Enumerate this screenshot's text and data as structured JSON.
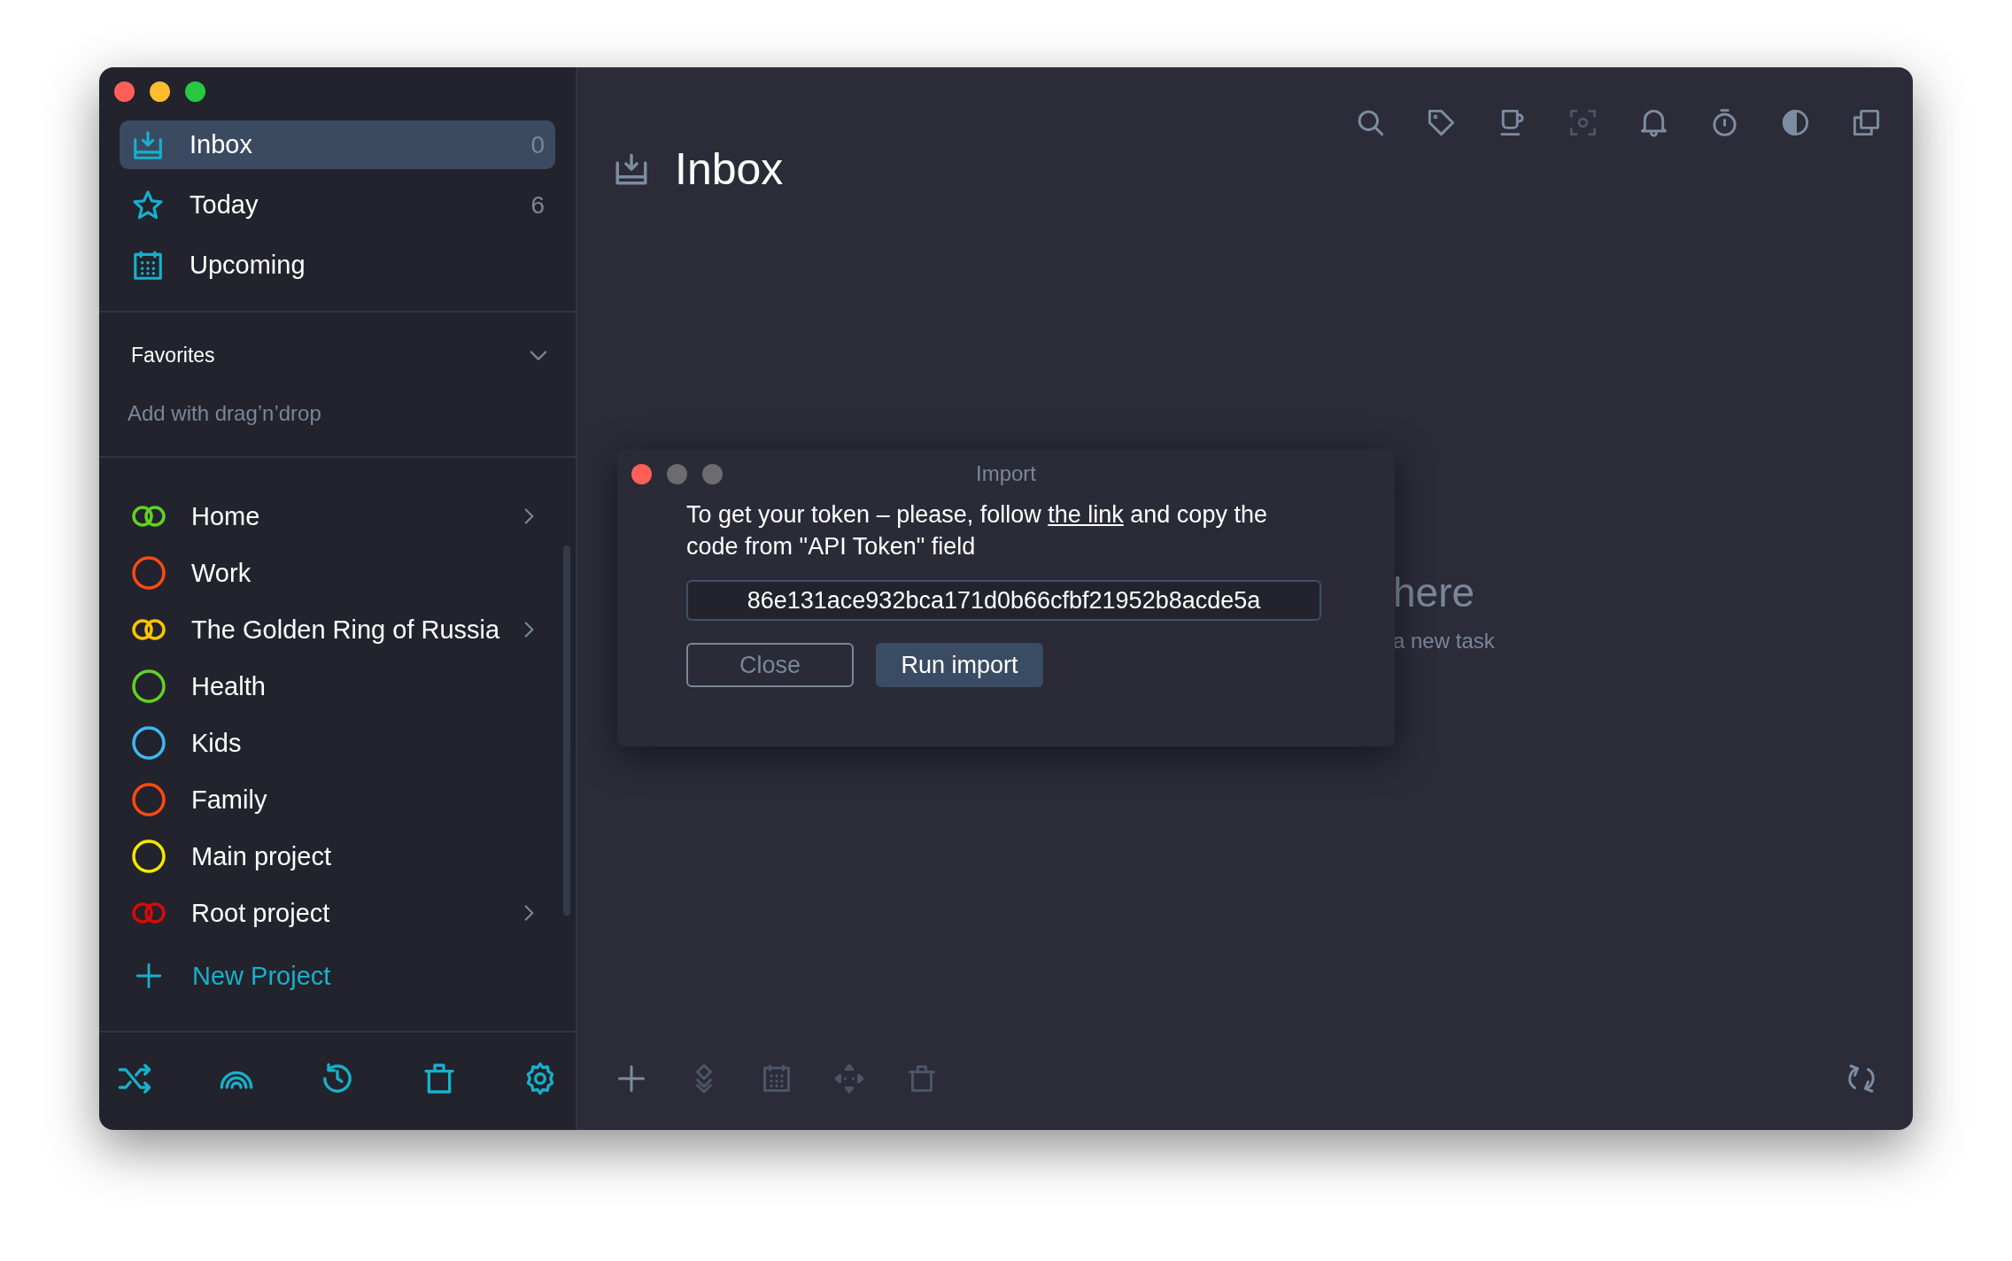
{
  "sidebar": {
    "nav": [
      {
        "label": "Inbox",
        "kind": "inbox",
        "count": "0",
        "selected": true
      },
      {
        "label": "Today",
        "kind": "star",
        "count": "6",
        "selected": false
      },
      {
        "label": "Upcoming",
        "kind": "calendar",
        "selected": false
      }
    ],
    "favorites": {
      "title": "Favorites",
      "expanded": true,
      "hint": "Add with drag’n’drop"
    },
    "projects": [
      {
        "name": "Home",
        "kind": "group",
        "color": "#5fd31f"
      },
      {
        "name": "Work",
        "kind": "project",
        "color": "#ff4a12"
      },
      {
        "name": "The Golden Ring of Russia",
        "kind": "group",
        "color": "#ffc400"
      },
      {
        "name": "Health",
        "kind": "project",
        "color": "#62d124"
      },
      {
        "name": "Kids",
        "kind": "project",
        "color": "#3db8f5"
      },
      {
        "name": "Family",
        "kind": "project",
        "color": "#ff4a12"
      },
      {
        "name": "Main project",
        "kind": "project",
        "color": "#f5e800"
      },
      {
        "name": "Root project",
        "kind": "group",
        "color": "#d60a0a"
      }
    ],
    "new_project": "New Project",
    "footer_tools": [
      {
        "kind": "shuffle"
      },
      {
        "kind": "rainbow"
      },
      {
        "kind": "history"
      },
      {
        "kind": "trash"
      },
      {
        "kind": "gear"
      }
    ]
  },
  "main": {
    "title": "Inbox",
    "toolbar": [
      {
        "kind": "search",
        "disabled": false
      },
      {
        "kind": "tag",
        "disabled": false
      },
      {
        "kind": "cup",
        "disabled": false
      },
      {
        "kind": "focus",
        "disabled": true
      },
      {
        "kind": "bell",
        "disabled": false
      },
      {
        "kind": "timer",
        "disabled": false
      },
      {
        "kind": "contrast",
        "disabled": false
      },
      {
        "kind": "copy",
        "disabled": false
      }
    ],
    "empty_state": {
      "title": "here",
      "hint": "a new task"
    },
    "bottom_toolbar": [
      {
        "kind": "plus",
        "disabled": false
      },
      {
        "kind": "layers",
        "disabled": true
      },
      {
        "kind": "calendar",
        "disabled": true
      },
      {
        "kind": "move",
        "disabled": true
      },
      {
        "kind": "trash",
        "disabled": true
      }
    ],
    "sync": {
      "kind": "sync"
    }
  },
  "dialog": {
    "title": "Import",
    "message": {
      "before": "To get your token – please, follow ",
      "link": "the link",
      "after": " and copy the code from \"API Token\" field"
    },
    "token": "86e131ace932bca171d0b66cfbf21952b8acde5a",
    "buttons": [
      {
        "label": "Close",
        "kind": "secondary"
      },
      {
        "label": "Run import",
        "kind": "primary"
      }
    ]
  }
}
